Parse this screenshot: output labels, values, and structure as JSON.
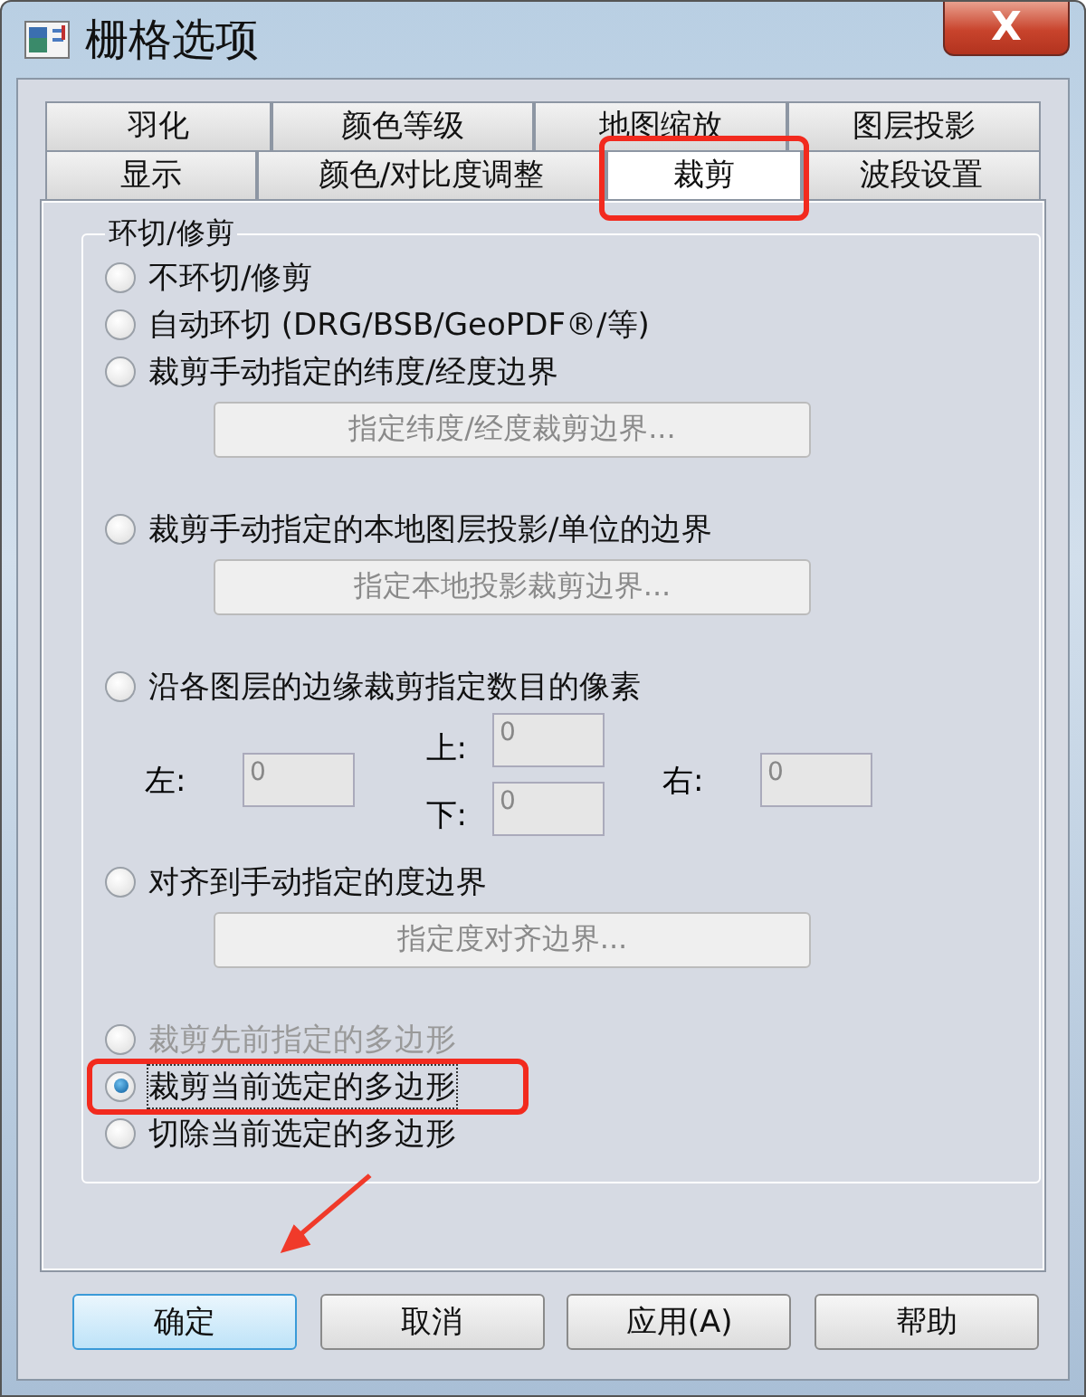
{
  "window": {
    "title": "栅格选项",
    "close": "X"
  },
  "tabs": [
    [
      {
        "label": "羽化",
        "selected": false,
        "highlighted": false
      },
      {
        "label": "颜色等级",
        "selected": false,
        "highlighted": false
      },
      {
        "label": "地图缩放",
        "selected": false,
        "highlighted": false
      },
      {
        "label": "图层投影",
        "selected": false,
        "highlighted": false
      }
    ],
    [
      {
        "label": "显示",
        "selected": false,
        "highlighted": false
      },
      {
        "label": "颜色/对比度调整",
        "selected": false,
        "highlighted": false
      },
      {
        "label": "裁剪",
        "selected": true,
        "highlighted": true
      },
      {
        "label": "波段设置",
        "selected": false,
        "highlighted": false
      }
    ]
  ],
  "group": {
    "label": "环切/修剪",
    "items": [
      {
        "kind": "radio",
        "label": "不环切/修剪",
        "selected": false,
        "disabled": false,
        "highlighted": false
      },
      {
        "kind": "radio",
        "label": "自动环切 (DRG/BSB/GeoPDF®/等)",
        "selected": false,
        "disabled": false,
        "highlighted": false
      },
      {
        "kind": "radio",
        "label": "裁剪手动指定的纬度/经度边界",
        "selected": false,
        "disabled": false,
        "highlighted": false
      },
      {
        "kind": "button",
        "label": "指定纬度/经度裁剪边界..."
      },
      {
        "kind": "radio",
        "label": "裁剪手动指定的本地图层投影/单位的边界",
        "selected": false,
        "disabled": false,
        "highlighted": false
      },
      {
        "kind": "button",
        "label": "指定本地投影裁剪边界..."
      },
      {
        "kind": "radio",
        "label": "沿各图层的边缘裁剪指定数目的像素",
        "selected": false,
        "disabled": false,
        "highlighted": false
      },
      {
        "kind": "margins",
        "left": {
          "label": "左:",
          "value": "0"
        },
        "top": {
          "label": "上:",
          "value": "0"
        },
        "right": {
          "label": "右:",
          "value": "0"
        },
        "bottom": {
          "label": "下:",
          "value": "0"
        }
      },
      {
        "kind": "radio",
        "label": "对齐到手动指定的度边界",
        "selected": false,
        "disabled": false,
        "highlighted": false
      },
      {
        "kind": "button",
        "label": "指定度对齐边界..."
      },
      {
        "kind": "radio",
        "label": "裁剪先前指定的多边形",
        "selected": false,
        "disabled": true,
        "highlighted": false
      },
      {
        "kind": "radio",
        "label": "裁剪当前选定的多边形",
        "selected": true,
        "disabled": false,
        "highlighted": true
      },
      {
        "kind": "radio",
        "label": "切除当前选定的多边形",
        "selected": false,
        "disabled": false,
        "highlighted": false
      }
    ]
  },
  "buttons": [
    {
      "label": "确定",
      "default": true
    },
    {
      "label": "取消",
      "default": false
    },
    {
      "label": "应用(A)",
      "default": false
    },
    {
      "label": "帮助",
      "default": false
    }
  ]
}
